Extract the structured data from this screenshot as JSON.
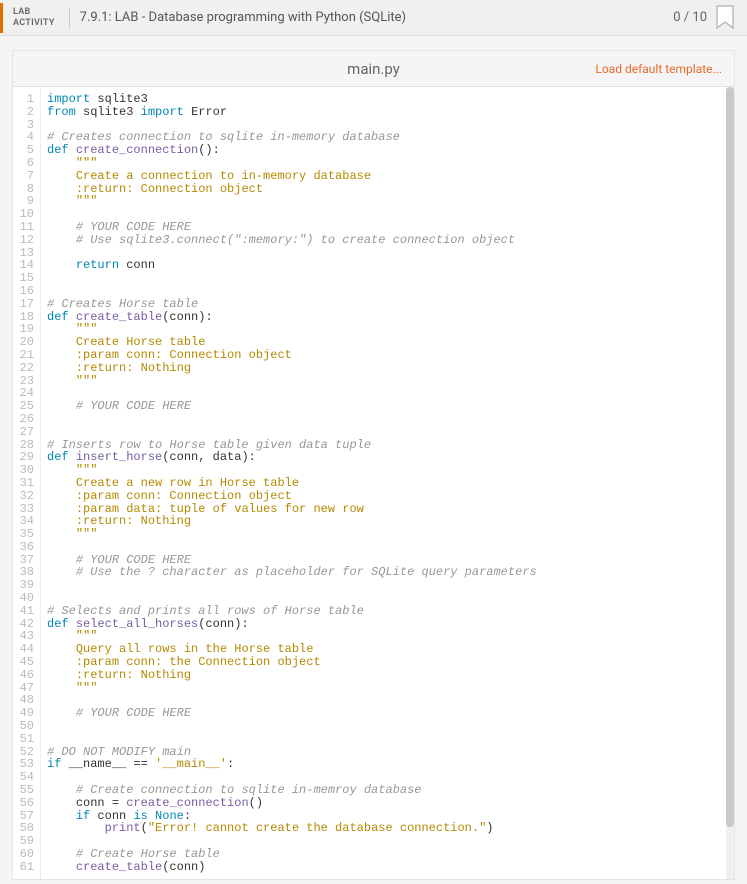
{
  "header": {
    "badge_line1": "LAB",
    "badge_line2": "ACTIVITY",
    "title": "7.9.1: LAB - Database programming with Python (SQLite)",
    "score": "0 / 10"
  },
  "tabbar": {
    "filename": "main.py",
    "load_template": "Load default template..."
  },
  "code": {
    "lines": [
      {
        "n": 1,
        "t": [
          [
            "kw",
            "import"
          ],
          [
            "sp",
            " "
          ],
          [
            "mod",
            "sqlite3"
          ]
        ]
      },
      {
        "n": 2,
        "t": [
          [
            "kw",
            "from"
          ],
          [
            "sp",
            " "
          ],
          [
            "mod",
            "sqlite3"
          ],
          [
            "sp",
            " "
          ],
          [
            "kw",
            "import"
          ],
          [
            "sp",
            " "
          ],
          [
            "mod",
            "Error"
          ]
        ]
      },
      {
        "n": 3,
        "t": []
      },
      {
        "n": 4,
        "t": [
          [
            "cm",
            "# Creates connection to sqlite in-memory database"
          ]
        ]
      },
      {
        "n": 5,
        "t": [
          [
            "def",
            "def"
          ],
          [
            "sp",
            " "
          ],
          [
            "fn",
            "create_connection"
          ],
          [
            "op",
            "():"
          ]
        ]
      },
      {
        "n": 6,
        "t": [
          [
            "sp",
            "    "
          ],
          [
            "doc",
            "\"\"\""
          ]
        ]
      },
      {
        "n": 7,
        "t": [
          [
            "sp",
            "    "
          ],
          [
            "doc",
            "Create a connection to in-memory database"
          ]
        ]
      },
      {
        "n": 8,
        "t": [
          [
            "sp",
            "    "
          ],
          [
            "doc",
            ":return: Connection object"
          ]
        ]
      },
      {
        "n": 9,
        "t": [
          [
            "sp",
            "    "
          ],
          [
            "doc",
            "\"\"\""
          ]
        ]
      },
      {
        "n": 10,
        "t": []
      },
      {
        "n": 11,
        "t": [
          [
            "sp",
            "    "
          ],
          [
            "cm",
            "# YOUR CODE HERE"
          ]
        ]
      },
      {
        "n": 12,
        "t": [
          [
            "sp",
            "    "
          ],
          [
            "cm",
            "# Use sqlite3.connect(\":memory:\") to create connection object"
          ]
        ]
      },
      {
        "n": 13,
        "t": []
      },
      {
        "n": 14,
        "t": [
          [
            "sp",
            "    "
          ],
          [
            "kw",
            "return"
          ],
          [
            "sp",
            " "
          ],
          [
            "mod",
            "conn"
          ]
        ]
      },
      {
        "n": 15,
        "t": []
      },
      {
        "n": 16,
        "t": []
      },
      {
        "n": 17,
        "t": [
          [
            "cm",
            "# Creates Horse table"
          ]
        ]
      },
      {
        "n": 18,
        "t": [
          [
            "def",
            "def"
          ],
          [
            "sp",
            " "
          ],
          [
            "fn",
            "create_table"
          ],
          [
            "op",
            "(conn):"
          ]
        ]
      },
      {
        "n": 19,
        "t": [
          [
            "sp",
            "    "
          ],
          [
            "doc",
            "\"\"\""
          ]
        ]
      },
      {
        "n": 20,
        "t": [
          [
            "sp",
            "    "
          ],
          [
            "doc",
            "Create Horse table"
          ]
        ]
      },
      {
        "n": 21,
        "t": [
          [
            "sp",
            "    "
          ],
          [
            "doc",
            ":param conn: Connection object"
          ]
        ]
      },
      {
        "n": 22,
        "t": [
          [
            "sp",
            "    "
          ],
          [
            "doc",
            ":return: Nothing"
          ]
        ]
      },
      {
        "n": 23,
        "t": [
          [
            "sp",
            "    "
          ],
          [
            "doc",
            "\"\"\""
          ]
        ]
      },
      {
        "n": 24,
        "t": []
      },
      {
        "n": 25,
        "t": [
          [
            "sp",
            "    "
          ],
          [
            "cm",
            "# YOUR CODE HERE"
          ]
        ]
      },
      {
        "n": 26,
        "t": []
      },
      {
        "n": 27,
        "t": []
      },
      {
        "n": 28,
        "t": [
          [
            "cm",
            "# Inserts row to Horse table given data tuple"
          ]
        ]
      },
      {
        "n": 29,
        "t": [
          [
            "def",
            "def"
          ],
          [
            "sp",
            " "
          ],
          [
            "fn",
            "insert_horse"
          ],
          [
            "op",
            "(conn, data):"
          ]
        ]
      },
      {
        "n": 30,
        "t": [
          [
            "sp",
            "    "
          ],
          [
            "doc",
            "\"\"\""
          ]
        ]
      },
      {
        "n": 31,
        "t": [
          [
            "sp",
            "    "
          ],
          [
            "doc",
            "Create a new row in Horse table"
          ]
        ]
      },
      {
        "n": 32,
        "t": [
          [
            "sp",
            "    "
          ],
          [
            "doc",
            ":param conn: Connection object"
          ]
        ]
      },
      {
        "n": 33,
        "t": [
          [
            "sp",
            "    "
          ],
          [
            "doc",
            ":param data: tuple of values for new row"
          ]
        ]
      },
      {
        "n": 34,
        "t": [
          [
            "sp",
            "    "
          ],
          [
            "doc",
            ":return: Nothing"
          ]
        ]
      },
      {
        "n": 35,
        "t": [
          [
            "sp",
            "    "
          ],
          [
            "doc",
            "\"\"\""
          ]
        ]
      },
      {
        "n": 36,
        "t": []
      },
      {
        "n": 37,
        "t": [
          [
            "sp",
            "    "
          ],
          [
            "cm",
            "# YOUR CODE HERE"
          ]
        ]
      },
      {
        "n": 38,
        "t": [
          [
            "sp",
            "    "
          ],
          [
            "cm",
            "# Use the ? character as placeholder for SQLite query parameters"
          ]
        ]
      },
      {
        "n": 39,
        "t": []
      },
      {
        "n": 40,
        "t": []
      },
      {
        "n": 41,
        "t": [
          [
            "cm",
            "# Selects and prints all rows of Horse table"
          ]
        ]
      },
      {
        "n": 42,
        "t": [
          [
            "def",
            "def"
          ],
          [
            "sp",
            " "
          ],
          [
            "fn",
            "select_all_horses"
          ],
          [
            "op",
            "(conn):"
          ]
        ]
      },
      {
        "n": 43,
        "t": [
          [
            "sp",
            "    "
          ],
          [
            "doc",
            "\"\"\""
          ]
        ]
      },
      {
        "n": 44,
        "t": [
          [
            "sp",
            "    "
          ],
          [
            "doc",
            "Query all rows in the Horse table"
          ]
        ]
      },
      {
        "n": 45,
        "t": [
          [
            "sp",
            "    "
          ],
          [
            "doc",
            ":param conn: the Connection object"
          ]
        ]
      },
      {
        "n": 46,
        "t": [
          [
            "sp",
            "    "
          ],
          [
            "doc",
            ":return: Nothing"
          ]
        ]
      },
      {
        "n": 47,
        "t": [
          [
            "sp",
            "    "
          ],
          [
            "doc",
            "\"\"\""
          ]
        ]
      },
      {
        "n": 48,
        "t": []
      },
      {
        "n": 49,
        "t": [
          [
            "sp",
            "    "
          ],
          [
            "cm",
            "# YOUR CODE HERE"
          ]
        ]
      },
      {
        "n": 50,
        "t": []
      },
      {
        "n": 51,
        "t": []
      },
      {
        "n": 52,
        "t": [
          [
            "cm",
            "# DO NOT MODIFY main"
          ]
        ]
      },
      {
        "n": 53,
        "t": [
          [
            "kw",
            "if"
          ],
          [
            "sp",
            " "
          ],
          [
            "mod",
            "__name__"
          ],
          [
            "sp",
            " "
          ],
          [
            "op",
            "=="
          ],
          [
            "sp",
            " "
          ],
          [
            "str",
            "'__main__'"
          ],
          [
            "op",
            ":"
          ]
        ]
      },
      {
        "n": 54,
        "t": []
      },
      {
        "n": 55,
        "t": [
          [
            "sp",
            "    "
          ],
          [
            "cm",
            "# Create connection to sqlite in-memroy database"
          ]
        ]
      },
      {
        "n": 56,
        "t": [
          [
            "sp",
            "    "
          ],
          [
            "mod",
            "conn "
          ],
          [
            "op",
            "="
          ],
          [
            "sp",
            " "
          ],
          [
            "fn",
            "create_connection"
          ],
          [
            "op",
            "()"
          ]
        ]
      },
      {
        "n": 57,
        "t": [
          [
            "sp",
            "    "
          ],
          [
            "kw",
            "if"
          ],
          [
            "sp",
            " "
          ],
          [
            "mod",
            "conn"
          ],
          [
            "sp",
            " "
          ],
          [
            "kw",
            "is"
          ],
          [
            "sp",
            " "
          ],
          [
            "kw",
            "None"
          ],
          [
            "op",
            ":"
          ]
        ]
      },
      {
        "n": 58,
        "t": [
          [
            "sp",
            "        "
          ],
          [
            "fn",
            "print"
          ],
          [
            "op",
            "("
          ],
          [
            "str",
            "\"Error! cannot create the database connection.\""
          ],
          [
            "op",
            ")"
          ]
        ]
      },
      {
        "n": 59,
        "t": []
      },
      {
        "n": 60,
        "t": [
          [
            "sp",
            "    "
          ],
          [
            "cm",
            "# Create Horse table"
          ]
        ]
      },
      {
        "n": 61,
        "t": [
          [
            "sp",
            "    "
          ],
          [
            "fn",
            "create_table"
          ],
          [
            "op",
            "(conn)"
          ]
        ]
      }
    ]
  }
}
